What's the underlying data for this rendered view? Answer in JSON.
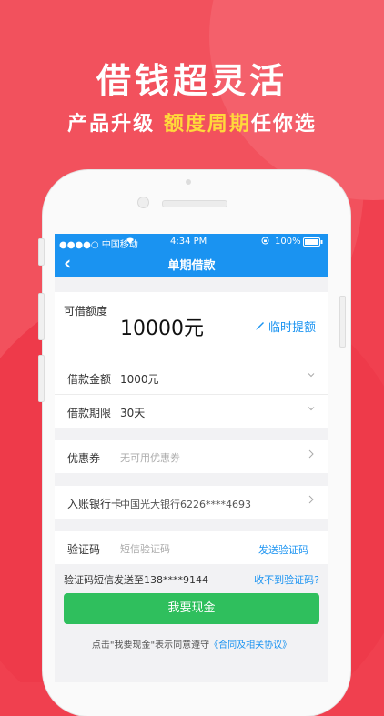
{
  "promo": {
    "headline": "借钱超灵活",
    "sub_prefix": "产品升级",
    "sub_highlight": "额度周期",
    "sub_suffix": "任你选"
  },
  "status": {
    "carrier": "●●●●○ 中国移动",
    "time": "4:34 PM",
    "battery": "100%"
  },
  "nav": {
    "title": "单期借款",
    "back": "‹"
  },
  "limit": {
    "label": "可借额度",
    "amount": "10000元",
    "raise": "临时提额"
  },
  "loan": {
    "amount_label": "借款金额",
    "amount_value": "1000元",
    "term_label": "借款期限",
    "term_value": "30天"
  },
  "coupon": {
    "label": "优惠券",
    "value": "无可用优惠券"
  },
  "bank": {
    "label": "入账银行卡",
    "value": "中国光大银行6226****4693"
  },
  "code": {
    "label": "验证码",
    "placeholder": "短信验证码",
    "send": "发送验证码",
    "sent_notice": "验证码短信发送至138****9144",
    "not_received": "收不到验证码?"
  },
  "submit": "我要现金",
  "agreement": {
    "text": "点击\"我要现金\"表示同意遵守",
    "link": "《合同及相关协议》"
  },
  "colors": {
    "brand_blue": "#1a93f1",
    "submit_green": "#2fbf5d",
    "promo_red": "#f0404f",
    "highlight_yellow": "#ffd93b"
  }
}
